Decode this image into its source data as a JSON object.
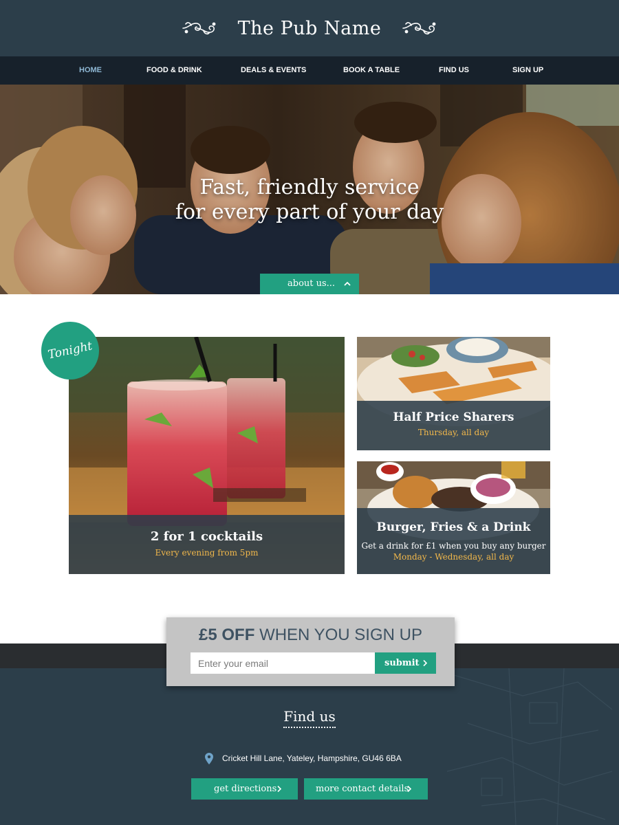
{
  "brand": {
    "title": "The Pub Name"
  },
  "nav": {
    "items": [
      {
        "label": "HOME",
        "active": true
      },
      {
        "label": "FOOD & DRINK"
      },
      {
        "label": "DEALS & EVENTS"
      },
      {
        "label": "BOOK A TABLE"
      },
      {
        "label": "FIND US"
      },
      {
        "label": "SIGN UP"
      }
    ]
  },
  "hero": {
    "line1": "Fast, friendly service",
    "line2": "for every part of your day",
    "about_label": "about us..."
  },
  "tonight_badge": "Tonight",
  "deals": {
    "cocktails": {
      "title": "2 for 1 cocktails",
      "subtitle": "Every evening from 5pm"
    },
    "sharers": {
      "title": "Half Price Sharers",
      "subtitle": "Thursday, all day"
    },
    "burger": {
      "title": "Burger, Fries & a Drink",
      "description": "Get a drink for £1 when you buy any burger",
      "subtitle": "Monday - Wednesday, all day"
    }
  },
  "signup": {
    "amount": "£5",
    "off": "OFF",
    "tail": "WHEN YOU SIGN UP",
    "email_placeholder": "Enter your email",
    "submit_label": "submit"
  },
  "find_us": {
    "title": "Find us",
    "address": "Cricket Hill Lane, Yateley,  Hampshire, GU46 6BA",
    "directions_label": "get directions",
    "contact_label": "more contact details"
  },
  "colors": {
    "header": "#2c3e4a",
    "nav": "#17212b",
    "accent_green": "#22a081",
    "highlight_yellow": "#f2b84b",
    "active_nav": "#8fb8d4"
  },
  "icons": {
    "flourish": "flourish-ornament-icon",
    "about_chevron": "chevron-up-icon",
    "button_chevron": "chevron-right-icon",
    "address": "map-pin-icon"
  }
}
